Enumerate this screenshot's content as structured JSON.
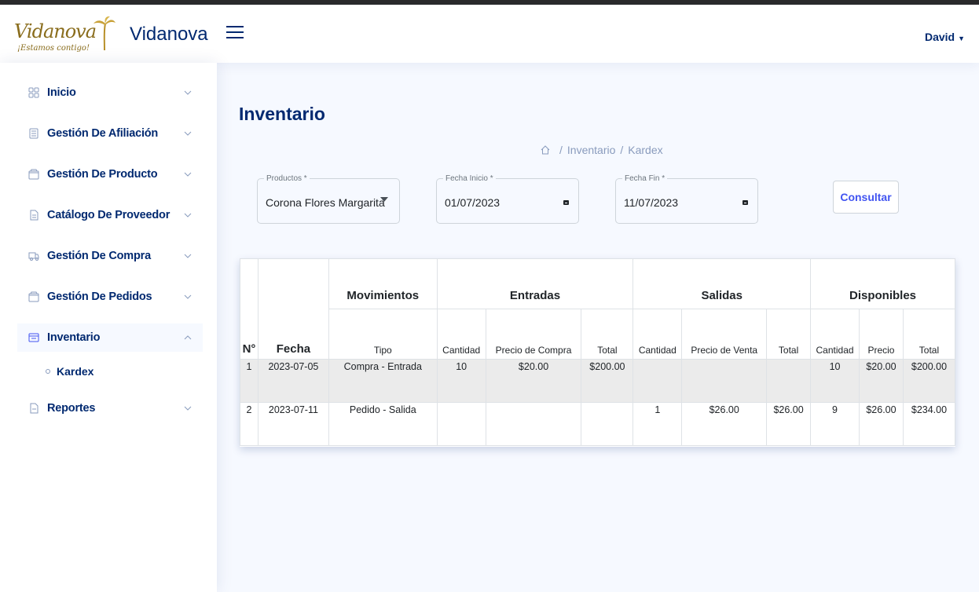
{
  "header": {
    "logo_text": "Vidanova",
    "logo_tagline": "¡Estamos contigo!",
    "brand": "Vidanova",
    "user": "David"
  },
  "sidebar": {
    "items": [
      {
        "label": "Inicio",
        "icon": "grid-icon"
      },
      {
        "label": "Gestión De Afiliación",
        "icon": "list-icon"
      },
      {
        "label": "Gestión De Producto",
        "icon": "box-icon"
      },
      {
        "label": "Catálogo De Proveedor",
        "icon": "document-icon"
      },
      {
        "label": "Gestión De Compra",
        "icon": "truck-icon"
      },
      {
        "label": "Gestión De Pedidos",
        "icon": "box-icon"
      },
      {
        "label": "Inventario",
        "icon": "layout-icon"
      },
      {
        "label": "Reportes",
        "icon": "file-icon"
      }
    ],
    "subitem": "Kardex"
  },
  "page": {
    "title": "Inventario",
    "breadcrumb": [
      "Inventario",
      "Kardex"
    ]
  },
  "filters": {
    "product_label": "Productos *",
    "product_value": "Corona Flores Margarita",
    "start_label": "Fecha Inicio *",
    "start_value": "01/07/2023",
    "end_label": "Fecha Fin *",
    "end_value": "11/07/2023",
    "submit": "Consultar"
  },
  "table": {
    "groups": [
      "Movimientos",
      "Entradas",
      "Salidas",
      "Disponibles"
    ],
    "col_no": "N°",
    "col_fecha": "Fecha",
    "sub": {
      "tipo": "Tipo",
      "e_cant": "Cantidad",
      "e_precio": "Precio de Compra",
      "e_total": "Total",
      "s_cant": "Cantidad",
      "s_precio": "Precio de Venta",
      "s_total": "Total",
      "d_cant": "Cantidad",
      "d_precio": "Precio",
      "d_total": "Total"
    },
    "rows": [
      {
        "n": "1",
        "fecha": "2023-07-05",
        "tipo": "Compra - Entrada",
        "e_cant": "10",
        "e_precio": "$20.00",
        "e_total": "$200.00",
        "s_cant": "",
        "s_precio": "",
        "s_total": "",
        "d_cant": "10",
        "d_precio": "$20.00",
        "d_total": "$200.00"
      },
      {
        "n": "2",
        "fecha": "2023-07-11",
        "tipo": "Pedido - Salida",
        "e_cant": "",
        "e_precio": "",
        "e_total": "",
        "s_cant": "1",
        "s_precio": "$26.00",
        "s_total": "$26.00",
        "d_cant": "9",
        "d_precio": "$26.00",
        "d_total": "$234.00"
      }
    ]
  }
}
